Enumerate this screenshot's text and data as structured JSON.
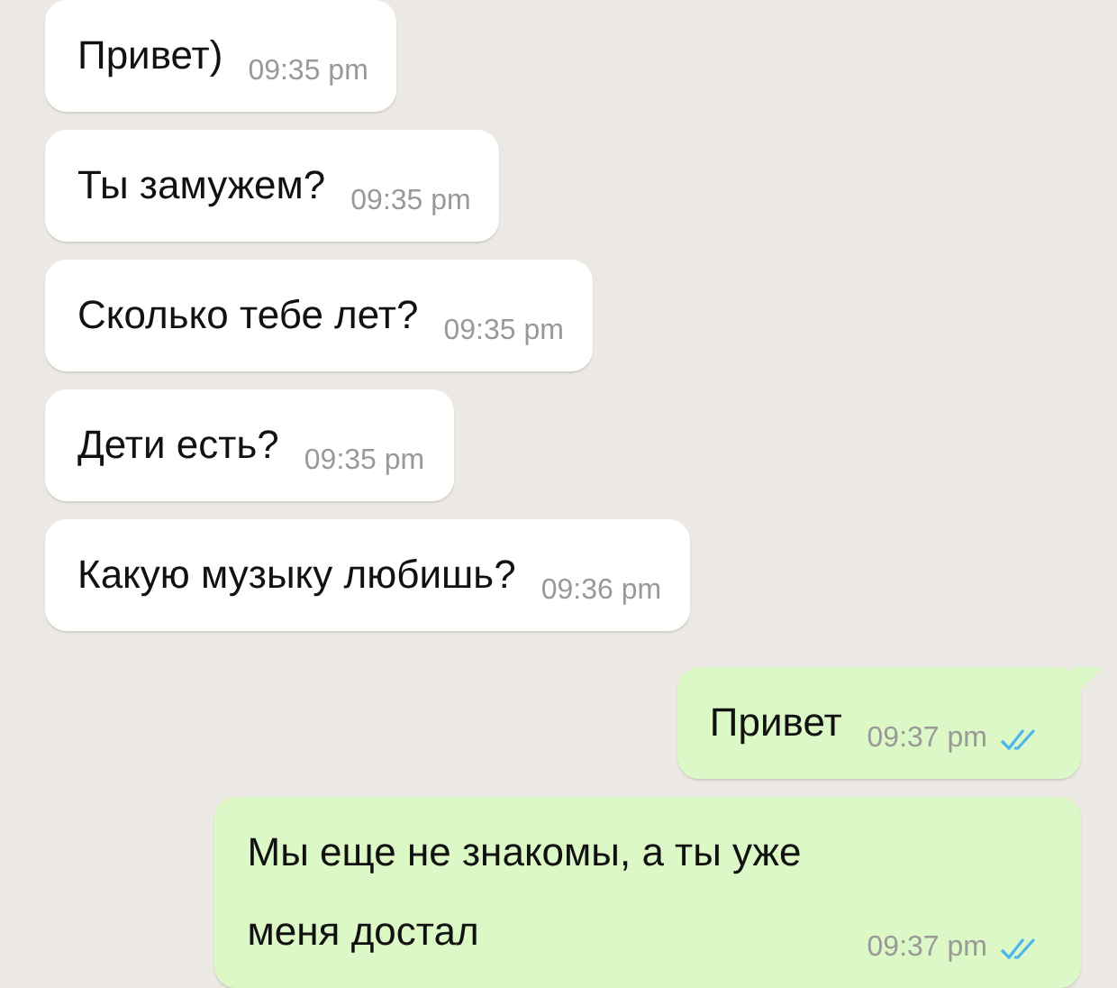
{
  "messages": [
    {
      "kind": "received",
      "text": "Привет)",
      "time": "09:35 pm"
    },
    {
      "kind": "received",
      "text": "Ты замужем?",
      "time": "09:35 pm"
    },
    {
      "kind": "received",
      "text": "Сколько тебе лет?",
      "time": "09:35 pm"
    },
    {
      "kind": "received",
      "text": "Дети есть?",
      "time": "09:35 pm"
    },
    {
      "kind": "received",
      "text": "Какую музыку любишь?",
      "time": "09:36 pm"
    },
    {
      "kind": "sent",
      "text": "Привет",
      "time": "09:37 pm",
      "read": true,
      "tail": true
    },
    {
      "kind": "sent",
      "text": "Мы еще не знакомы, а ты уже меня достал",
      "time": "09:37 pm",
      "read": true,
      "tail": false
    }
  ]
}
